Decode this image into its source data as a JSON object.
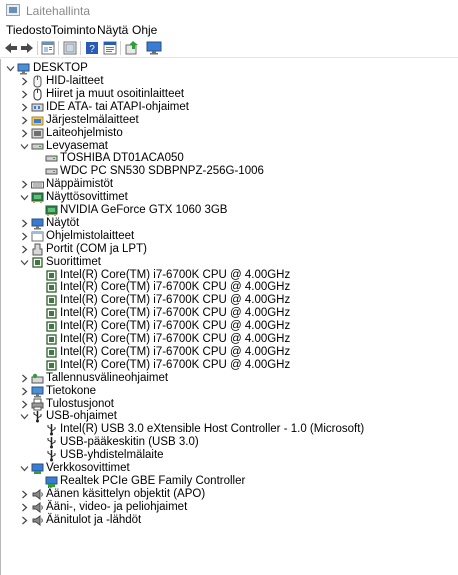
{
  "window": {
    "title": "Laitehallinta"
  },
  "menu": [
    "Tiedosto",
    "Toiminto",
    "Näytä",
    "Ohje"
  ],
  "toolbar": [
    "back-icon",
    "forward-icon",
    "properties-icon",
    "show-hidden-icon",
    "help-icon",
    "details-icon",
    "update-driver-icon",
    "monitor-icon"
  ],
  "tree": {
    "root": "DESKTOP",
    "rows": [
      {
        "label": "HID-laitteet",
        "level": 1,
        "state": "collapsed",
        "icon": "hid-icon"
      },
      {
        "label": "Hiiret ja muut osoitinlaitteet",
        "level": 1,
        "state": "collapsed",
        "icon": "mouse-icon"
      },
      {
        "label": "IDE ATA- tai ATAPI-ohjaimet",
        "level": 1,
        "state": "collapsed",
        "icon": "ide-icon"
      },
      {
        "label": "Järjestelmälaitteet",
        "level": 1,
        "state": "collapsed",
        "icon": "system-folder-icon"
      },
      {
        "label": "Laiteohjelmisto",
        "level": 1,
        "state": "collapsed",
        "icon": "firmware-icon"
      },
      {
        "label": "Levyasemat",
        "level": 1,
        "state": "expanded",
        "icon": "disk-icon"
      },
      {
        "label": "TOSHIBA DT01ACA050",
        "level": 2,
        "state": "leaf",
        "icon": "disk-icon"
      },
      {
        "label": "WDC PC SN530 SDBPNPZ-256G-1006",
        "level": 2,
        "state": "leaf",
        "icon": "disk-icon"
      },
      {
        "label": "Näppäimistöt",
        "level": 1,
        "state": "collapsed",
        "icon": "keyboard-icon"
      },
      {
        "label": "Näyttösovittimet",
        "level": 1,
        "state": "expanded",
        "icon": "display-adapter-icon"
      },
      {
        "label": "NVIDIA GeForce GTX 1060 3GB",
        "level": 2,
        "state": "leaf",
        "icon": "display-adapter-icon"
      },
      {
        "label": "Näytöt",
        "level": 1,
        "state": "collapsed",
        "icon": "monitor-icon"
      },
      {
        "label": "Ohjelmistolaitteet",
        "level": 1,
        "state": "collapsed",
        "icon": "software-device-icon"
      },
      {
        "label": "Portit (COM ja LPT)",
        "level": 1,
        "state": "collapsed",
        "icon": "port-icon"
      },
      {
        "label": "Suorittimet",
        "level": 1,
        "state": "expanded",
        "icon": "processor-icon"
      },
      {
        "label": "Intel(R) Core(TM) i7-6700K CPU @ 4.00GHz",
        "level": 2,
        "state": "leaf",
        "icon": "processor-icon"
      },
      {
        "label": "Intel(R) Core(TM) i7-6700K CPU @ 4.00GHz",
        "level": 2,
        "state": "leaf",
        "icon": "processor-icon"
      },
      {
        "label": "Intel(R) Core(TM) i7-6700K CPU @ 4.00GHz",
        "level": 2,
        "state": "leaf",
        "icon": "processor-icon"
      },
      {
        "label": "Intel(R) Core(TM) i7-6700K CPU @ 4.00GHz",
        "level": 2,
        "state": "leaf",
        "icon": "processor-icon"
      },
      {
        "label": "Intel(R) Core(TM) i7-6700K CPU @ 4.00GHz",
        "level": 2,
        "state": "leaf",
        "icon": "processor-icon"
      },
      {
        "label": "Intel(R) Core(TM) i7-6700K CPU @ 4.00GHz",
        "level": 2,
        "state": "leaf",
        "icon": "processor-icon"
      },
      {
        "label": "Intel(R) Core(TM) i7-6700K CPU @ 4.00GHz",
        "level": 2,
        "state": "leaf",
        "icon": "processor-icon"
      },
      {
        "label": "Intel(R) Core(TM) i7-6700K CPU @ 4.00GHz",
        "level": 2,
        "state": "leaf",
        "icon": "processor-icon"
      },
      {
        "label": "Tallennusvälineohjaimet",
        "level": 1,
        "state": "collapsed",
        "icon": "storage-controller-icon"
      },
      {
        "label": "Tietokone",
        "level": 1,
        "state": "collapsed",
        "icon": "computer-icon"
      },
      {
        "label": "Tulostusjonot",
        "level": 1,
        "state": "collapsed",
        "icon": "printer-icon"
      },
      {
        "label": "USB-ohjaimet",
        "level": 1,
        "state": "expanded",
        "icon": "usb-icon"
      },
      {
        "label": "Intel(R) USB 3.0 eXtensible Host Controller - 1.0 (Microsoft)",
        "level": 2,
        "state": "leaf",
        "icon": "usb-icon"
      },
      {
        "label": "USB-pääkeskitin (USB 3.0)",
        "level": 2,
        "state": "leaf",
        "icon": "usb-icon"
      },
      {
        "label": "USB-yhdistelmälaite",
        "level": 2,
        "state": "leaf",
        "icon": "usb-icon"
      },
      {
        "label": "Verkkosovittimet",
        "level": 1,
        "state": "expanded",
        "icon": "network-adapter-icon"
      },
      {
        "label": "Realtek PCIe GBE Family Controller",
        "level": 2,
        "state": "leaf",
        "icon": "network-adapter-icon"
      },
      {
        "label": "Äänen käsittelyn objektit (APO)",
        "level": 1,
        "state": "collapsed",
        "icon": "speaker-icon"
      },
      {
        "label": "Ääni-, video- ja peliohjaimet",
        "level": 1,
        "state": "collapsed",
        "icon": "speaker-icon"
      },
      {
        "label": "Äänitulot ja -lähdöt",
        "level": 1,
        "state": "collapsed",
        "icon": "speaker-icon"
      }
    ]
  }
}
